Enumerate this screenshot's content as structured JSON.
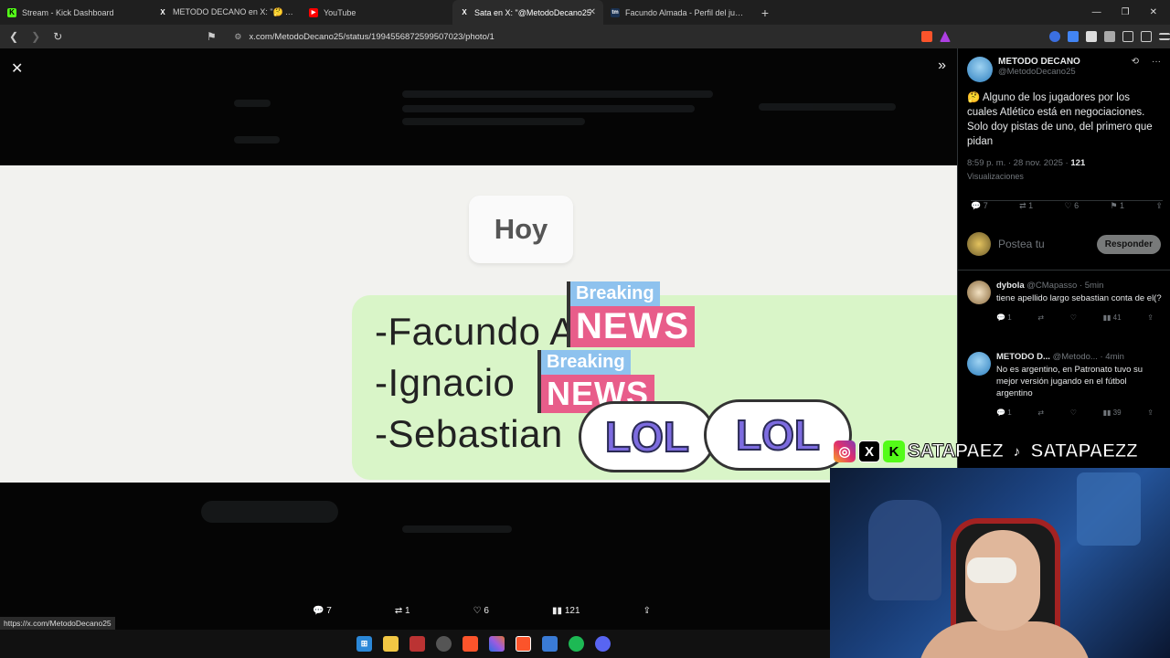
{
  "browser": {
    "tabs": [
      {
        "label": "Stream - Kick Dashboard",
        "fav_text": "K",
        "fav_color": "#53fc18"
      },
      {
        "label": "METODO DECANO en X: \"🤔 Alguno d",
        "fav_text": "X",
        "fav_color": "#000000"
      },
      {
        "label": "YouTube",
        "fav_text": "▶",
        "fav_color": "#ff0000"
      },
      {
        "label": "Sata en X: \"@MetodoDecano25",
        "fav_text": "X",
        "fav_color": "#000000",
        "active": true
      },
      {
        "label": "Facundo Almada - Perfil del jugador",
        "fav_text": "tm",
        "fav_color": "#1a3151"
      }
    ],
    "new_tab": "+",
    "url": "x.com/MetodoDecano25/status/1994556872599507023/photo/1",
    "status_url": "https://x.com/MetodoDecano25"
  },
  "viewer": {
    "close_icon": "close-icon",
    "expand_icon": "expand-icon",
    "photo": {
      "date_bubble": "Hoy",
      "lines": [
        "-Facundo A",
        "-Ignacio",
        "-Sebastian"
      ],
      "breaking": "Breaking",
      "news": "NEWS",
      "lol": "LOL"
    },
    "actions": {
      "replies": "7",
      "reposts": "1",
      "likes": "6",
      "views": "121"
    }
  },
  "tweet": {
    "author_name": "METODO DECANO",
    "author_handle": "@MetodoDecano25",
    "text": "🤔 Alguno de los jugadores por los cuales Atlético está en negociaciones. Solo doy pistas de uno, del primero que pidan",
    "time": "8:59 p. m. · 28 nov. 2025 ·",
    "views_count": "121",
    "views_label": "Visualizaciones",
    "actions": {
      "replies": "7",
      "reposts": "1",
      "likes": "6",
      "bookmarks": "1"
    },
    "reply_placeholder": "Postea tu",
    "reply_button": "Responder"
  },
  "replies": [
    {
      "name": "dybola",
      "handle": "@CMapasso · 5min",
      "text": "tiene apellido largo sebastian conta de el(?",
      "replies": "1",
      "views": "41"
    },
    {
      "name": "METODO D...",
      "handle": "@Metodo... · 4min",
      "text": "No es argentino, en Patronato tuvo su mejor versión jugando en el fútbol argentino",
      "replies": "1",
      "views": "39"
    }
  ],
  "overlay": {
    "kick_handle": "SATAPAEZ",
    "tiktok_handle": "SATAPAEZZ"
  },
  "colors": {
    "accent": "#1d9bf0",
    "kick": "#53fc18",
    "bubble": "#d9f5c8"
  }
}
